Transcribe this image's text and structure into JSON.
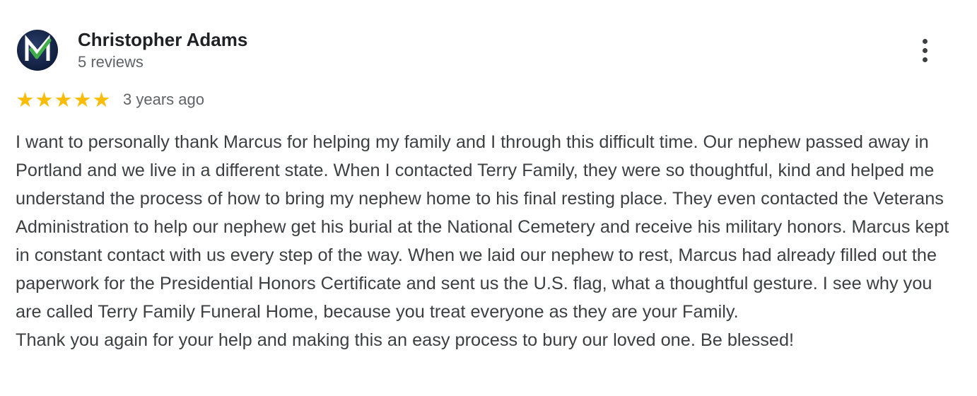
{
  "review": {
    "author_name": "Christopher Adams",
    "review_count": "5 reviews",
    "rating": 5,
    "rating_max": 5,
    "date": "3 years ago",
    "avatar_icon": "checkmark-logo-icon",
    "more_icon": "more-vert-icon",
    "star_color": "#fbbc04",
    "paragraphs": [
      "I want to personally thank Marcus for helping my family and I through this difficult time. Our nephew passed away in Portland and we live in a different state. When I contacted Terry Family, they were so thoughtful, kind and helped me understand the process of how to bring my nephew home to his final resting place. They even contacted the Veterans Administration to help our nephew get his burial at the National Cemetery and receive his military honors. Marcus kept in constant contact with us every step of the way. When we laid our nephew to rest, Marcus had already filled out the paperwork for the Presidential Honors Certificate and sent us the U.S. flag, what a thoughtful gesture. I see why you are called Terry Family Funeral Home, because you treat everyone as they are your Family.",
      "Thank you again for your help and making this an easy process to bury our loved one. Be blessed!"
    ]
  }
}
